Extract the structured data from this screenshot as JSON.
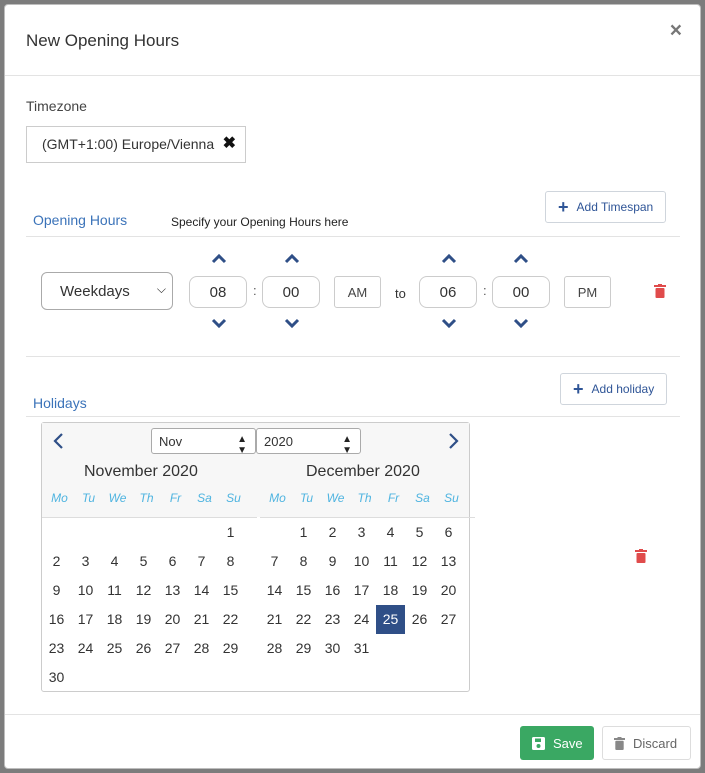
{
  "dialog": {
    "title": "New Opening Hours",
    "close_icon": "×"
  },
  "timezone": {
    "label": "Timezone",
    "value": "(GMT+1:00) Europe/Vienna",
    "clear_icon": "✖"
  },
  "opening_hours": {
    "title": "Opening Hours",
    "hint": "Specify your Opening Hours here",
    "add_label": "Add Timespan",
    "row": {
      "day_select": "Weekdays",
      "from_hour": "08",
      "from_minute": "00",
      "from_ampm": "AM",
      "to_label": "to",
      "to_hour": "06",
      "to_minute": "00",
      "to_ampm": "PM",
      "separator": ":"
    }
  },
  "holidays": {
    "title": "Holidays",
    "add_label": "Add holiday",
    "calendar": {
      "month_select": "Nov",
      "year_select": "2020",
      "weekdays": [
        "Mo",
        "Tu",
        "We",
        "Th",
        "Fr",
        "Sa",
        "Su"
      ],
      "months": [
        {
          "name": "November 2020",
          "weeks": [
            [
              "",
              "",
              "",
              "",
              "",
              "",
              "1"
            ],
            [
              "2",
              "3",
              "4",
              "5",
              "6",
              "7",
              "8"
            ],
            [
              "9",
              "10",
              "11",
              "12",
              "13",
              "14",
              "15"
            ],
            [
              "16",
              "17",
              "18",
              "19",
              "20",
              "21",
              "22"
            ],
            [
              "23",
              "24",
              "25",
              "26",
              "27",
              "28",
              "29"
            ],
            [
              "30",
              "",
              "",
              "",
              "",
              "",
              ""
            ]
          ]
        },
        {
          "name": "December 2020",
          "weeks": [
            [
              "",
              "1",
              "2",
              "3",
              "4",
              "5",
              "6"
            ],
            [
              "7",
              "8",
              "9",
              "10",
              "11",
              "12",
              "13"
            ],
            [
              "14",
              "15",
              "16",
              "17",
              "18",
              "19",
              "20"
            ],
            [
              "21",
              "22",
              "23",
              "24",
              "25",
              "26",
              "27"
            ],
            [
              "28",
              "29",
              "30",
              "31",
              "",
              "",
              ""
            ]
          ]
        }
      ],
      "selected": "25"
    }
  },
  "footer": {
    "save_label": "Save",
    "discard_label": "Discard"
  },
  "colors": {
    "accent_blue": "#3b73b9",
    "save_green": "#3aa863",
    "delete_red": "#e04b4b",
    "selected_day": "#2f4f87"
  }
}
